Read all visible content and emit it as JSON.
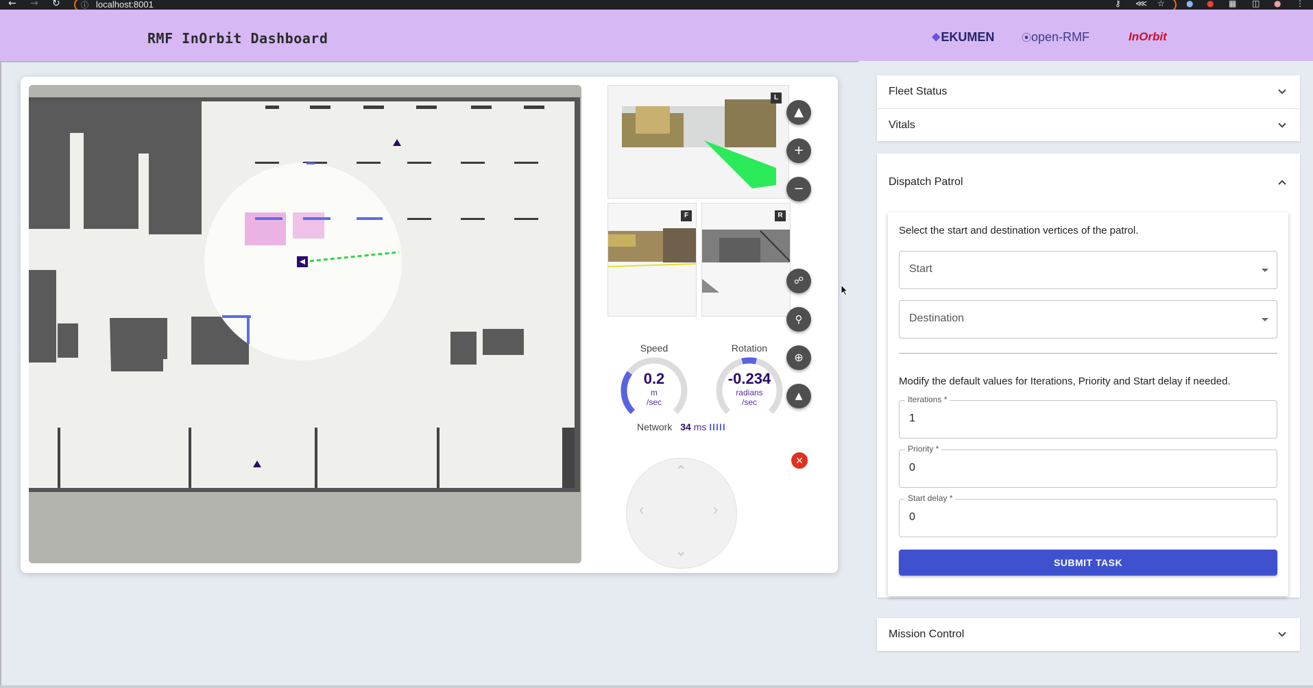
{
  "browser": {
    "url": "localhost:8001",
    "info_icon": "info-icon"
  },
  "header": {
    "title": "RMF InOrbit Dashboard",
    "logos": {
      "ekumen": "EKUMEN",
      "openrmf": "open-RMF",
      "inorbit": "InOrbit"
    }
  },
  "robot": {
    "cameras": {
      "left_tag": "L",
      "front_tag": "F",
      "rear_tag": "R"
    },
    "speed": {
      "label": "Speed",
      "value": "0.2",
      "unit_line1": "m",
      "unit_line2": "/sec",
      "fraction": 0.3
    },
    "rotation": {
      "label": "Rotation",
      "value": "-0.234",
      "unit_line1": "radians",
      "unit_line2": "/sec",
      "fraction": 0.1
    },
    "network": {
      "label": "Network",
      "latency": "34",
      "unit": "ms",
      "bars": "IIIII"
    }
  },
  "panel": {
    "fleet_status": "Fleet Status",
    "vitals": "Vitals",
    "dispatch_patrol": "Dispatch Patrol",
    "mission_control": "Mission Control"
  },
  "dispatch": {
    "intro": "Select the start and destination vertices of the patrol.",
    "start_placeholder": "Start",
    "destination_placeholder": "Destination",
    "modify_text": "Modify the default values for Iterations, Priority and Start delay if needed.",
    "iterations_label": "Iterations *",
    "iterations_value": "1",
    "priority_label": "Priority *",
    "priority_value": "0",
    "start_delay_label": "Start delay *",
    "start_delay_value": "0",
    "submit_label": "SUBMIT TASK"
  },
  "colors": {
    "header_bg": "#d6b8f5",
    "accent_blue": "#3f51cf",
    "robot_purple": "#2a0a6e",
    "path_green": "#2fd34a",
    "close_red": "#e0301e"
  }
}
